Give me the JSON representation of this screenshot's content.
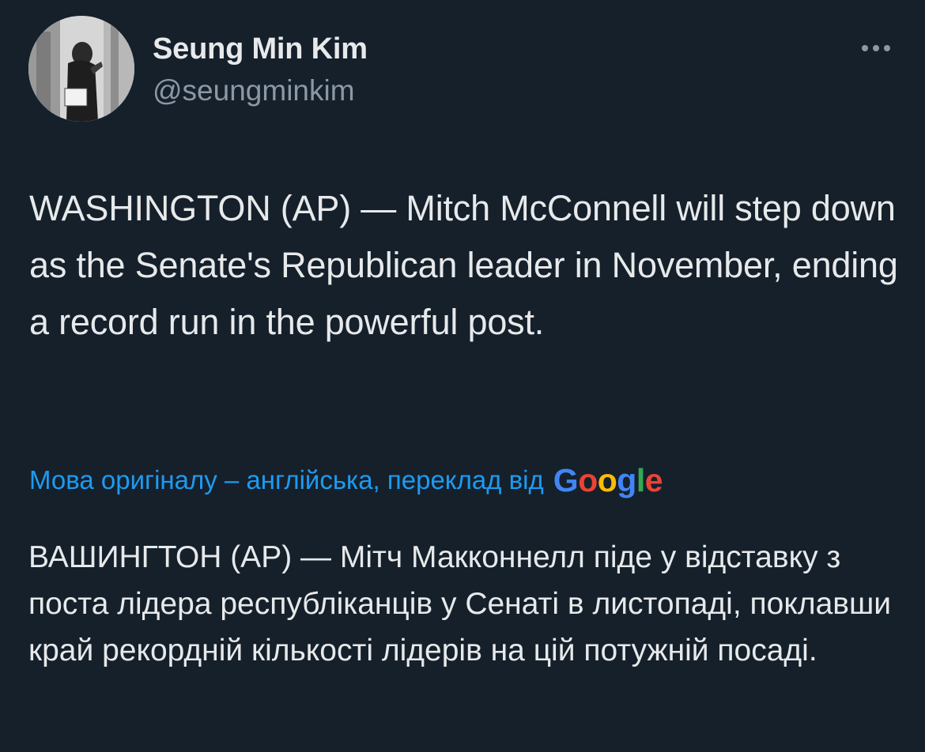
{
  "author": {
    "display_name": "Seung Min Kim",
    "handle": "@seungminkim",
    "avatar_icon": "profile-photo"
  },
  "menu": {
    "icon": "more-dots-icon"
  },
  "tweet": {
    "text": "WASHINGTON (AP) — Mitch McConnell will step down as the Senate's Republican leader in November, ending a record run in the powerful post."
  },
  "translation": {
    "attribution_text": "Мова оригіналу – англійська, переклад від",
    "provider_letters": [
      "G",
      "o",
      "o",
      "g",
      "l",
      "e"
    ],
    "provider_colors": [
      "#4285f4",
      "#ea4335",
      "#fbbc05",
      "#4285f4",
      "#34a853",
      "#ea4335"
    ],
    "translated_text": "ВАШИНГТОН (AP) — Мітч Макконнелл піде у відставку з поста лідера республіканців у Сенаті в листопаді, поклавши край рекордній кількості лідерів на цій потужній посаді."
  },
  "colors": {
    "background": "#15202b",
    "primary_text": "#e7e9ea",
    "secondary_text": "#8b98a5",
    "link": "#1d9bf0"
  }
}
